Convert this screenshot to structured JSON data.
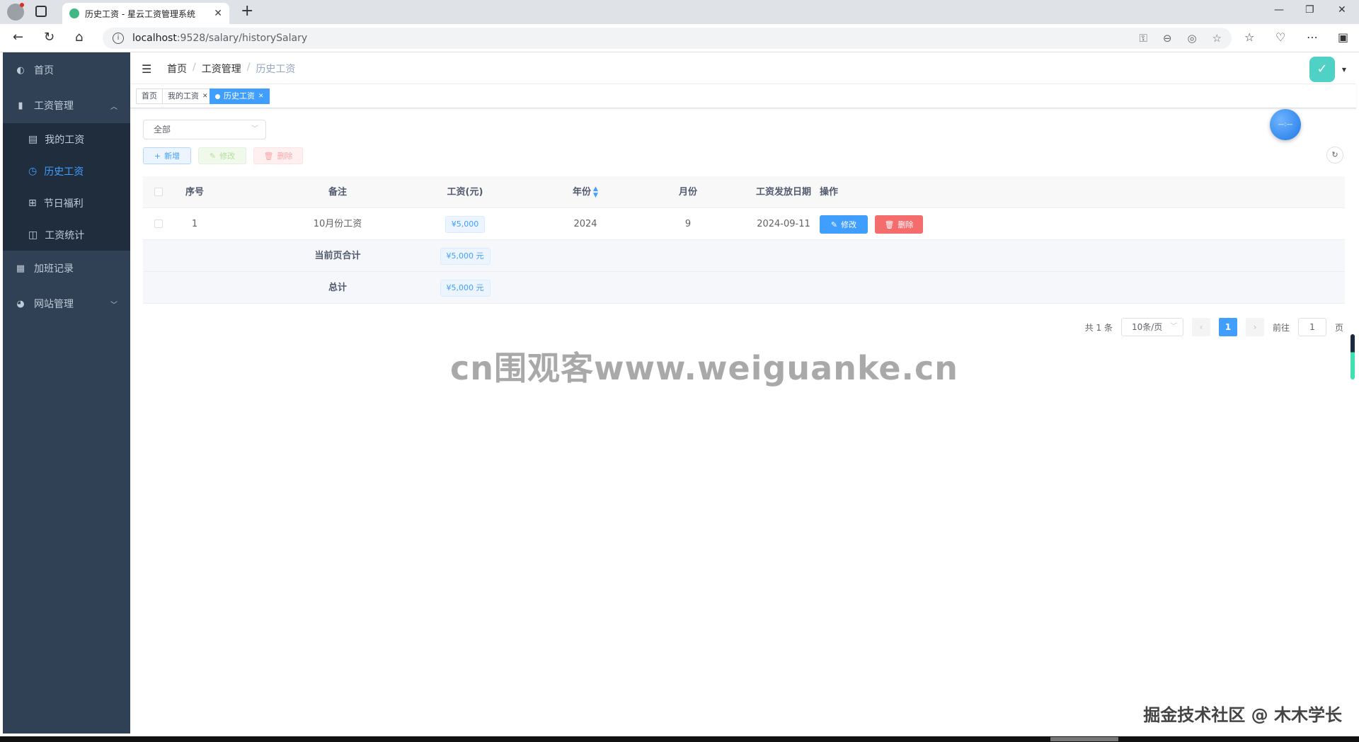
{
  "browser": {
    "tab_title": "历史工资 - 星云工资管理系统",
    "url_host": "localhost",
    "url_path": ":9528/salary/historySalary"
  },
  "sidebar": {
    "items": [
      {
        "label": "首页",
        "icon": "dashboard-icon"
      },
      {
        "label": "工资管理",
        "icon": "money-icon",
        "expanded": true
      },
      {
        "label": "加班记录",
        "icon": "calendar-icon"
      },
      {
        "label": "网站管理",
        "icon": "globe-icon"
      }
    ],
    "sub_items": [
      {
        "label": "我的工资",
        "icon": "wallet-icon"
      },
      {
        "label": "历史工资",
        "icon": "clock-icon",
        "active": true
      },
      {
        "label": "节日福利",
        "icon": "gift-icon"
      },
      {
        "label": "工资统计",
        "icon": "chart-icon"
      }
    ]
  },
  "breadcrumb": [
    "首页",
    "工资管理",
    "历史工资"
  ],
  "tags": [
    {
      "label": "首页"
    },
    {
      "label": "我的工资"
    },
    {
      "label": "历史工资",
      "active": true
    }
  ],
  "filter": {
    "selected": "全部"
  },
  "toolbar": {
    "add": "新增",
    "edit": "修改",
    "delete": "删除"
  },
  "table": {
    "headers": [
      "序号",
      "备注",
      "工资(元)",
      "年份",
      "月份",
      "工资发放日期",
      "操作"
    ],
    "rows": [
      {
        "index": "1",
        "remark": "10月份工资",
        "salary": "¥5,000",
        "year": "2024",
        "month": "9",
        "date": "2024-09-11",
        "edit": "修改",
        "delete": "删除"
      }
    ],
    "page_sum_label": "当前页合计",
    "page_sum_value": "¥5,000 元",
    "total_label": "总计",
    "total_value": "¥5,000 元"
  },
  "pagination": {
    "total": "共 1 条",
    "page_size": "10条/页",
    "current": "1",
    "goto_label": "前往",
    "goto_value": "1",
    "goto_suffix": "页"
  },
  "overlay": {
    "watermark": "cn围观客www.weiguanke.cn",
    "footer_mark": "掘金技术社区 @ 木木学长"
  },
  "colors": {
    "primary": "#409eff",
    "danger": "#f56c6c",
    "sidebar": "#304156"
  }
}
